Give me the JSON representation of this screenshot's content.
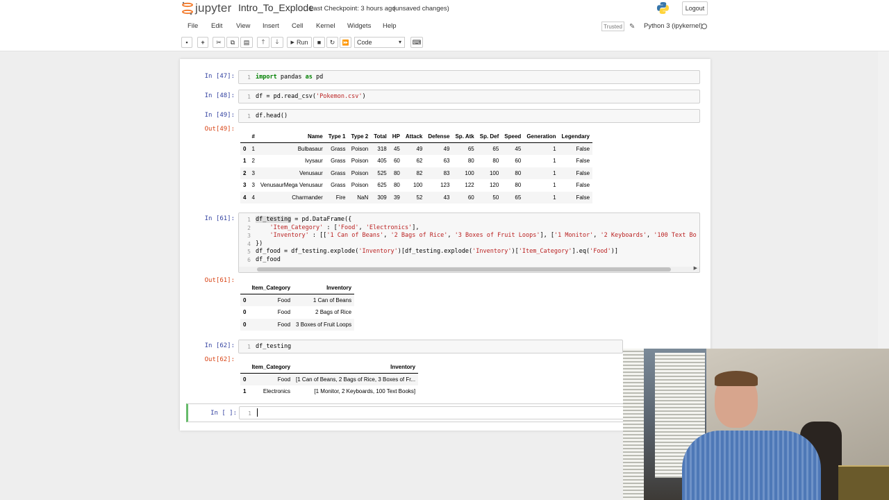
{
  "header": {
    "logo_text": "jupyter",
    "notebook_name": "Intro_To_Explode",
    "checkpoint": "Last Checkpoint: 3 hours ago",
    "autosave": "(unsaved changes)",
    "logout_label": "Logout"
  },
  "menu": {
    "items": [
      "File",
      "Edit",
      "View",
      "Insert",
      "Cell",
      "Kernel",
      "Widgets",
      "Help"
    ],
    "trusted": "Trusted",
    "kernel": "Python 3 (ipykernel)"
  },
  "toolbar": {
    "run_label": "Run",
    "cell_type": "Code"
  },
  "cells": {
    "c47": {
      "prompt": "In [47]:",
      "line": "1",
      "code_kw1": "import",
      "code_mid": " pandas ",
      "code_kw2": "as",
      "code_end": " pd"
    },
    "c48": {
      "prompt": "In [48]:",
      "line": "1",
      "code_pre": "df = pd.read_csv(",
      "code_str": "'Pokemon.csv'",
      "code_post": ")"
    },
    "c49": {
      "prompt": "In [49]:",
      "line": "1",
      "code": "df.head()",
      "out_prompt": "Out[49]:"
    },
    "c61": {
      "prompt": "In [61]:",
      "out_prompt": "Out[61]:",
      "lines": [
        "1",
        "2",
        "3",
        "4",
        "5",
        "6"
      ],
      "l1_hl": "df_testing",
      "l1_rest": " = pd.DataFrame({",
      "l2_pre": "    ",
      "l2_s1": "'Item_Category'",
      "l2_mid": " : [",
      "l2_s2": "'Food'",
      "l2_c": ", ",
      "l2_s3": "'Electronics'",
      "l2_end": "],",
      "l3_pre": "    ",
      "l3_s1": "'Inventory'",
      "l3_mid": " : [[",
      "l3_s2": "'1 Can of Beans'",
      "l3_c1": ", ",
      "l3_s3": "'2 Bags of Rice'",
      "l3_c2": ", ",
      "l3_s4": "'3 Boxes of Fruit Loops'",
      "l3_c3": "], [",
      "l3_s5": "'1 Monitor'",
      "l3_c4": ", ",
      "l3_s6": "'2 Keyboards'",
      "l3_c5": ", ",
      "l3_s7": "'100 Text Bo",
      "l4": "})",
      "l5_pre": "df_food = df_testing.explode(",
      "l5_s1": "'Inventory'",
      "l5_mid": ")[df_testing.explode(",
      "l5_s2": "'Inventory'",
      "l5_mid2": ")[",
      "l5_s3": "'Item_Category'",
      "l5_mid3": "].eq(",
      "l5_s4": "'Food'",
      "l5_end": ")]",
      "l6": "df_food"
    },
    "c62": {
      "prompt": "In [62]:",
      "line": "1",
      "code": "df_testing",
      "out_prompt": "Out[62]:"
    },
    "empty": {
      "prompt": "In [ ]:",
      "line": "1"
    }
  },
  "tables": {
    "pokemon": {
      "columns": [
        "",
        "#",
        "Name",
        "Type 1",
        "Type 2",
        "Total",
        "HP",
        "Attack",
        "Defense",
        "Sp. Atk",
        "Sp. Def",
        "Speed",
        "Generation",
        "Legendary"
      ],
      "rows": [
        [
          "0",
          "1",
          "Bulbasaur",
          "Grass",
          "Poison",
          "318",
          "45",
          "49",
          "49",
          "65",
          "65",
          "45",
          "1",
          "False"
        ],
        [
          "1",
          "2",
          "Ivysaur",
          "Grass",
          "Poison",
          "405",
          "60",
          "62",
          "63",
          "80",
          "80",
          "60",
          "1",
          "False"
        ],
        [
          "2",
          "3",
          "Venusaur",
          "Grass",
          "Poison",
          "525",
          "80",
          "82",
          "83",
          "100",
          "100",
          "80",
          "1",
          "False"
        ],
        [
          "3",
          "3",
          "VenusaurMega Venusaur",
          "Grass",
          "Poison",
          "625",
          "80",
          "100",
          "123",
          "122",
          "120",
          "80",
          "1",
          "False"
        ],
        [
          "4",
          "4",
          "Charmander",
          "Fire",
          "NaN",
          "309",
          "39",
          "52",
          "43",
          "60",
          "50",
          "65",
          "1",
          "False"
        ]
      ]
    },
    "food": {
      "columns": [
        "",
        "Item_Category",
        "Inventory"
      ],
      "rows": [
        [
          "0",
          "Food",
          "1 Can of Beans"
        ],
        [
          "0",
          "Food",
          "2 Bags of Rice"
        ],
        [
          "0",
          "Food",
          "3 Boxes of Fruit Loops"
        ]
      ]
    },
    "testing": {
      "columns": [
        "",
        "Item_Category",
        "Inventory"
      ],
      "rows": [
        [
          "0",
          "Food",
          "[1 Can of Beans, 2 Bags of Rice, 3 Boxes of Fr..."
        ],
        [
          "1",
          "Electronics",
          "[1 Monitor, 2 Keyboards, 100 Text Books]"
        ]
      ]
    }
  },
  "colors": {
    "in_prompt": "#303f9f",
    "out_prompt": "#d84315",
    "string": "#ba2121",
    "keyword": "#008000",
    "active_cell": "#66bb6a"
  },
  "icons": [
    "jupyter-logo-icon",
    "python-icon",
    "save-icon",
    "plus-icon",
    "cut-icon",
    "copy-icon",
    "paste-icon",
    "move-up-icon",
    "move-down-icon",
    "run-icon",
    "stop-icon",
    "restart-icon",
    "fast-forward-icon",
    "keyboard-icon",
    "pencil-icon"
  ]
}
